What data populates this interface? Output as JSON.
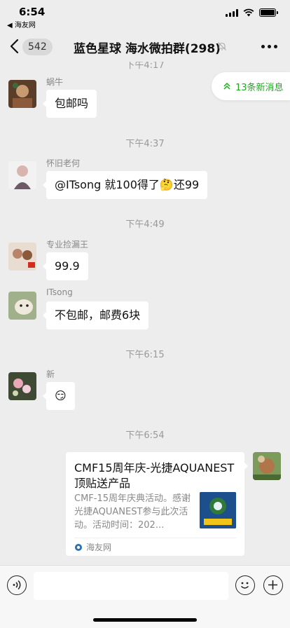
{
  "status": {
    "time": "6:54",
    "back_app": "◀ 海友网"
  },
  "nav": {
    "unread_count": "542",
    "title": "蓝色星球 海水微拍群(298)"
  },
  "new_messages": "13条新消息",
  "timestamps": [
    "下午4:17",
    "下午4:37",
    "下午4:49",
    "下午6:15",
    "下午6:54"
  ],
  "messages": [
    {
      "nickname": "蜗牛",
      "text": "包邮吗"
    },
    {
      "nickname": "怀旧老何",
      "text": "@ITsong 就100得了🤔还99"
    },
    {
      "nickname": "专业捡漏王",
      "text": "99.9"
    },
    {
      "nickname": "ITsong",
      "text": "不包邮，邮费6块"
    },
    {
      "nickname": "新",
      "text": "😏"
    }
  ],
  "link_card": {
    "title": "CMF15周年庆-光捷AQUANEST顶贴送产品",
    "description": "CMF-15周年庆典活动。感谢光捷AQUANEST参与此次活动。活动时间：202...",
    "source": "海友网"
  },
  "input": {
    "placeholder": ""
  },
  "colors": {
    "accent": "#1aad19",
    "background": "#ededed",
    "bubble": "#ffffff"
  }
}
